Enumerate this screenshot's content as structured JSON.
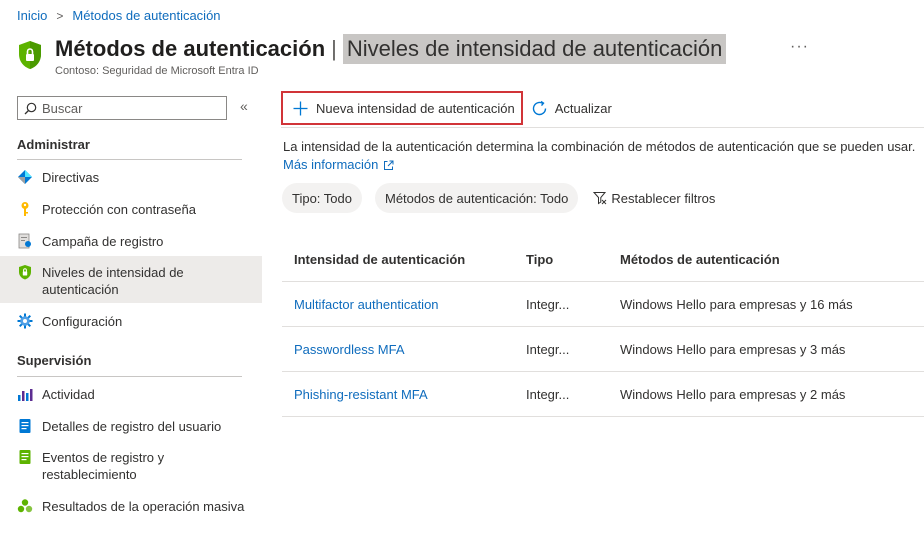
{
  "breadcrumb": {
    "home": "Inicio",
    "current": "Métodos de autenticación"
  },
  "header": {
    "title": "Métodos de autenticación",
    "separator": "|",
    "subtitle_highlight": "Niveles de intensidad de autenticación",
    "org": "Contoso: Seguridad de Microsoft Entra ID",
    "more": "···"
  },
  "sidebar": {
    "search_placeholder": "Buscar",
    "collapse": "«",
    "sections": [
      {
        "title": "Administrar"
      },
      {
        "title": "Supervisión"
      }
    ],
    "items": [
      {
        "label": "Directivas",
        "icon": "policy-icon"
      },
      {
        "label": "Protección con contraseña",
        "icon": "key-icon"
      },
      {
        "label": "Campaña de registro",
        "icon": "registration-icon"
      },
      {
        "label": "Niveles de intensidad de autenticación",
        "icon": "shield-icon",
        "active": true
      },
      {
        "label": "Configuración",
        "icon": "gear-icon"
      },
      {
        "label": "Actividad",
        "icon": "activity-chart-icon"
      },
      {
        "label": "Detalles de registro del usuario",
        "icon": "user-details-icon"
      },
      {
        "label": "Eventos de registro y restablecimiento",
        "icon": "events-icon"
      },
      {
        "label": "Resultados de la operación masiva",
        "icon": "bulk-results-icon"
      }
    ]
  },
  "toolbar": {
    "new_label": "Nueva intensidad de autenticación",
    "refresh_label": "Actualizar"
  },
  "description": {
    "text": "La intensidad de la autenticación determina la combinación de métodos de autenticación que se pueden usar.",
    "link": "Más información"
  },
  "filters": {
    "type": "Tipo: Todo",
    "methods": "Métodos de autenticación: Todo",
    "reset": "Restablecer filtros"
  },
  "table": {
    "headers": [
      "Intensidad de autenticación",
      "Tipo",
      "Métodos de autenticación"
    ],
    "rows": [
      {
        "name": "Multifactor authentication",
        "type": "Integr...",
        "methods": "Windows Hello para empresas y 16 más"
      },
      {
        "name": "Passwordless MFA",
        "type": "Integr...",
        "methods": "Windows Hello para empresas y 3 más"
      },
      {
        "name": "Phishing-resistant MFA",
        "type": "Integr...",
        "methods": "Windows Hello para empresas y 2 más"
      }
    ]
  },
  "colors": {
    "link": "#0f6cbd",
    "highlight_border": "#d13438",
    "shield": "#5db300"
  }
}
